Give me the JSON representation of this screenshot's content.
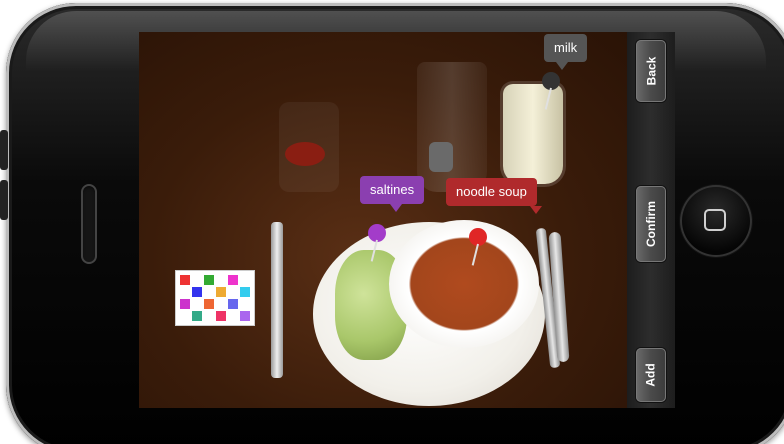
{
  "toolbar": {
    "back_label": "Back",
    "confirm_label": "Confirm",
    "add_label": "Add"
  },
  "tags": {
    "milk": "milk",
    "saltines": "saltines",
    "soup": "noodle soup"
  },
  "colors": {
    "milk_tag": "#555555",
    "saltines_tag": "#8b3fb0",
    "soup_tag": "#b02a2c",
    "toolbar_bg": "#2d2d2d"
  },
  "icons": {
    "home": "home-square-icon",
    "pin": "push-pin-icon"
  }
}
